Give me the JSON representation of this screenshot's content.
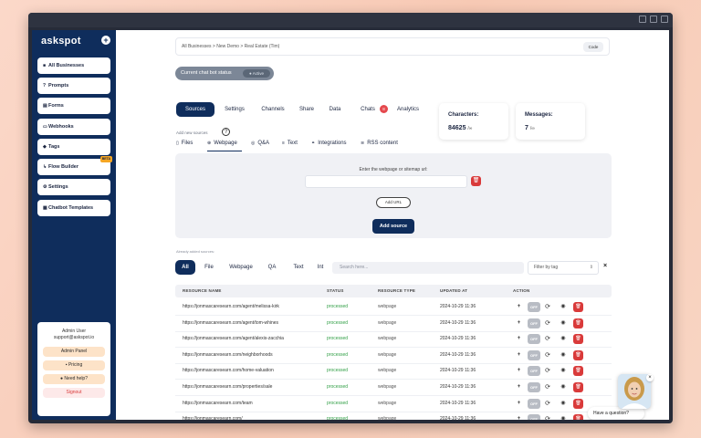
{
  "sidebar": {
    "logo": "askspot",
    "nav": [
      {
        "label": "All Businesses",
        "icon": "building-icon"
      },
      {
        "label": "Prompts",
        "icon": "question-icon"
      },
      {
        "label": "Forms",
        "icon": "form-icon"
      },
      {
        "label": "Webhooks",
        "icon": "webhook-icon"
      },
      {
        "label": "Tags",
        "icon": "tag-icon"
      },
      {
        "label": "Flow Builder",
        "icon": "flow-icon",
        "badge": "BETA"
      },
      {
        "label": "Settings",
        "icon": "gear-icon"
      },
      {
        "label": "Chatbot Templates",
        "icon": "template-icon"
      }
    ],
    "user": {
      "name": "Admin User",
      "email": "support@askspot.io",
      "admin_panel": "Admin Panel",
      "pricing": "Pricing",
      "need_help": "Need help?",
      "signout": "Signout"
    }
  },
  "header": {
    "breadcrumb": "All Businesses  >  New Demo  >  Real Estate (Tim)",
    "code_button": "Code"
  },
  "status": {
    "label": "Current chat bot status",
    "value": "Active"
  },
  "tabs": [
    {
      "label": "Sources",
      "active": true
    },
    {
      "label": "Settings"
    },
    {
      "label": "Channels"
    },
    {
      "label": "Share"
    },
    {
      "label": "Data"
    },
    {
      "label": "Chats",
      "badge": "8"
    },
    {
      "label": "Analytics"
    }
  ],
  "stats": {
    "characters_title": "Characters:",
    "characters_value": "84625",
    "characters_suffix": "/∞",
    "messages_title": "Messages:",
    "messages_value": "7",
    "messages_suffix": "/∞"
  },
  "sources": {
    "add_text": "Add new sources",
    "help": "?",
    "subtabs": [
      {
        "label": "Files",
        "icon": "file-icon"
      },
      {
        "label": "Webpage",
        "icon": "globe-icon"
      },
      {
        "label": "Q&A",
        "icon": "qa-icon"
      },
      {
        "label": "Text",
        "icon": "text-icon"
      },
      {
        "label": "Integrations",
        "icon": "plug-icon"
      },
      {
        "label": "RSS content",
        "icon": "rss-icon"
      }
    ],
    "webpage_label": "Enter the webpage or sitemap url:",
    "url_value": "",
    "add_url": "Add URL",
    "add_source": "Add source"
  },
  "list": {
    "already_text": "Already added sources:",
    "filters": [
      "All",
      "File",
      "Webpage",
      "QA",
      "Text",
      "Int"
    ],
    "search_placeholder": "Search here...",
    "tag_placeholder": "Filter by tag",
    "clear": "×",
    "columns": [
      "RESOURCE NAME",
      "STATUS",
      "RESOURCE TYPE",
      "UPDATED AT",
      "ACTION"
    ],
    "rows": [
      {
        "name": "https://jonmascaresearn.com/agent/melissa-kirk",
        "status": "processed",
        "type": "webpage",
        "updated": "2024-10-29 11:36"
      },
      {
        "name": "https://jonmascaresearn.com/agent/tom-whines",
        "status": "processed",
        "type": "webpage",
        "updated": "2024-10-29 11:36"
      },
      {
        "name": "https://jonmascaresearn.com/agent/alexis-zacchia",
        "status": "processed",
        "type": "webpage",
        "updated": "2024-10-29 11:36"
      },
      {
        "name": "https://jonmascaresearn.com/neighborhoods",
        "status": "processed",
        "type": "webpage",
        "updated": "2024-10-29 11:36"
      },
      {
        "name": "https://jonmascaresearn.com/home-valuation",
        "status": "processed",
        "type": "webpage",
        "updated": "2024-10-29 11:36"
      },
      {
        "name": "https://jonmascaresearn.com/properties/sale",
        "status": "processed",
        "type": "webpage",
        "updated": "2024-10-29 11:36"
      },
      {
        "name": "https://jonmascaresearn.com/team",
        "status": "processed",
        "type": "webpage",
        "updated": "2024-10-29 11:36"
      },
      {
        "name": "https://jonmascaresearn.com/",
        "status": "processed",
        "type": "webpage",
        "updated": "2024-10-29 11:36"
      }
    ],
    "off_label": "OFF"
  },
  "chat_widget": {
    "prompt": "Have a question?",
    "close": "×"
  },
  "colors": {
    "brand": "#0f2d5c",
    "danger": "#d93a3a",
    "success": "#2f9e44"
  }
}
